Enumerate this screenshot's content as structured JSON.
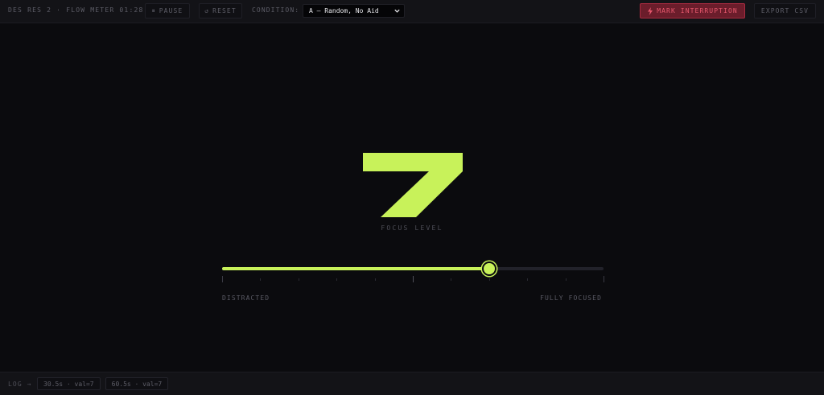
{
  "header": {
    "title": "DES RES 2 · FLOW METER",
    "timer": "01:28",
    "pause_label": "PAUSE",
    "reset_label": "RESET",
    "condition_label": "CONDITION:",
    "condition_value": "A — Random, No Aid",
    "mark_label": "MARK INTERRUPTION",
    "export_label": "EXPORT CSV"
  },
  "focus": {
    "value": 7,
    "label": "FOCUS LEVEL",
    "min": 0,
    "max": 10,
    "min_label": "DISTRACTED",
    "max_label": "FULLY FOCUSED"
  },
  "log": {
    "label": "LOG →",
    "entries": [
      "30.5s · val=7",
      "60.5s · val=7"
    ]
  },
  "colors": {
    "accent": "#c8f25a",
    "danger": "#e8596e",
    "danger_bg": "#6b1d2b",
    "background": "#0b0b0e",
    "bar": "#131317"
  }
}
